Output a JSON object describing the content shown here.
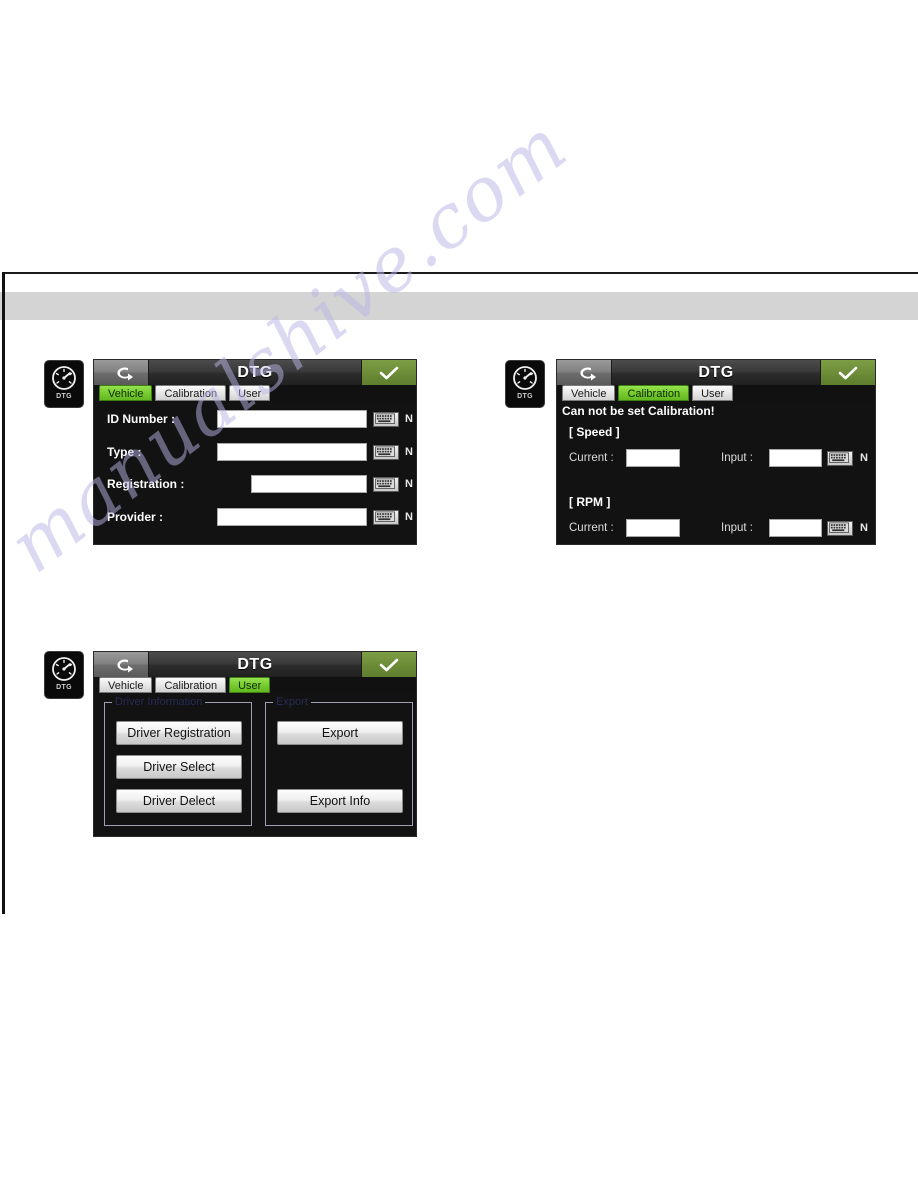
{
  "page": {
    "watermark": "manualshive.com"
  },
  "app_icon": {
    "label": "DTG",
    "icon": "gauge-icon"
  },
  "common": {
    "title": "DTG",
    "back_icon": "back-arrow-icon",
    "confirm_icon": "checkmark-icon",
    "keyboard_icon": "keyboard-icon",
    "n_marker": "N",
    "tabs": [
      "Vehicle",
      "Calibration",
      "User"
    ]
  },
  "screens": [
    {
      "id": "vehicle",
      "title": "DTG",
      "active_tab": "Vehicle",
      "tabs": [
        "Vehicle",
        "Calibration",
        "User"
      ],
      "fields": [
        {
          "label": "ID Number :",
          "value": "",
          "keyboard": "keyboard-icon",
          "marker": "N"
        },
        {
          "label": "Type :",
          "value": "",
          "keyboard": "keyboard-icon",
          "marker": "N"
        },
        {
          "label": "Registration :",
          "value": "",
          "keyboard": "keyboard-icon",
          "marker": "N"
        },
        {
          "label": "Provider :",
          "value": "",
          "keyboard": "keyboard-icon",
          "marker": "N"
        }
      ]
    },
    {
      "id": "calibration",
      "title": "DTG",
      "active_tab": "Calibration",
      "tabs": [
        "Vehicle",
        "Calibration",
        "User"
      ],
      "alert": "Can not be set Calibration!",
      "sections": [
        {
          "heading": "[ Speed ]",
          "current_label": "Current :",
          "current_value": "",
          "input_label": "Input :",
          "input_value": "",
          "keyboard": "keyboard-icon",
          "marker": "N"
        },
        {
          "heading": "[ RPM ]",
          "current_label": "Current :",
          "current_value": "",
          "input_label": "Input :",
          "input_value": "",
          "keyboard": "keyboard-icon",
          "marker": "N"
        }
      ]
    },
    {
      "id": "user",
      "title": "DTG",
      "active_tab": "User",
      "tabs": [
        "Vehicle",
        "Calibration",
        "User"
      ],
      "groups": [
        {
          "legend": "Driver Information",
          "buttons": [
            "Driver Registration",
            "Driver Select",
            "Driver Delect"
          ]
        },
        {
          "legend": "Export",
          "buttons": [
            "Export",
            "Export Info"
          ]
        }
      ]
    }
  ],
  "colors": {
    "tab_active": "#79cc2e",
    "confirm_button": "#6d8d38",
    "panel_background": "#121212",
    "titlebar": "#3a3a3a",
    "field_background": "#ffffff",
    "group_border": "#9f9fb4",
    "legend_text": "#272b55",
    "page_band": "#d4d4d4"
  }
}
